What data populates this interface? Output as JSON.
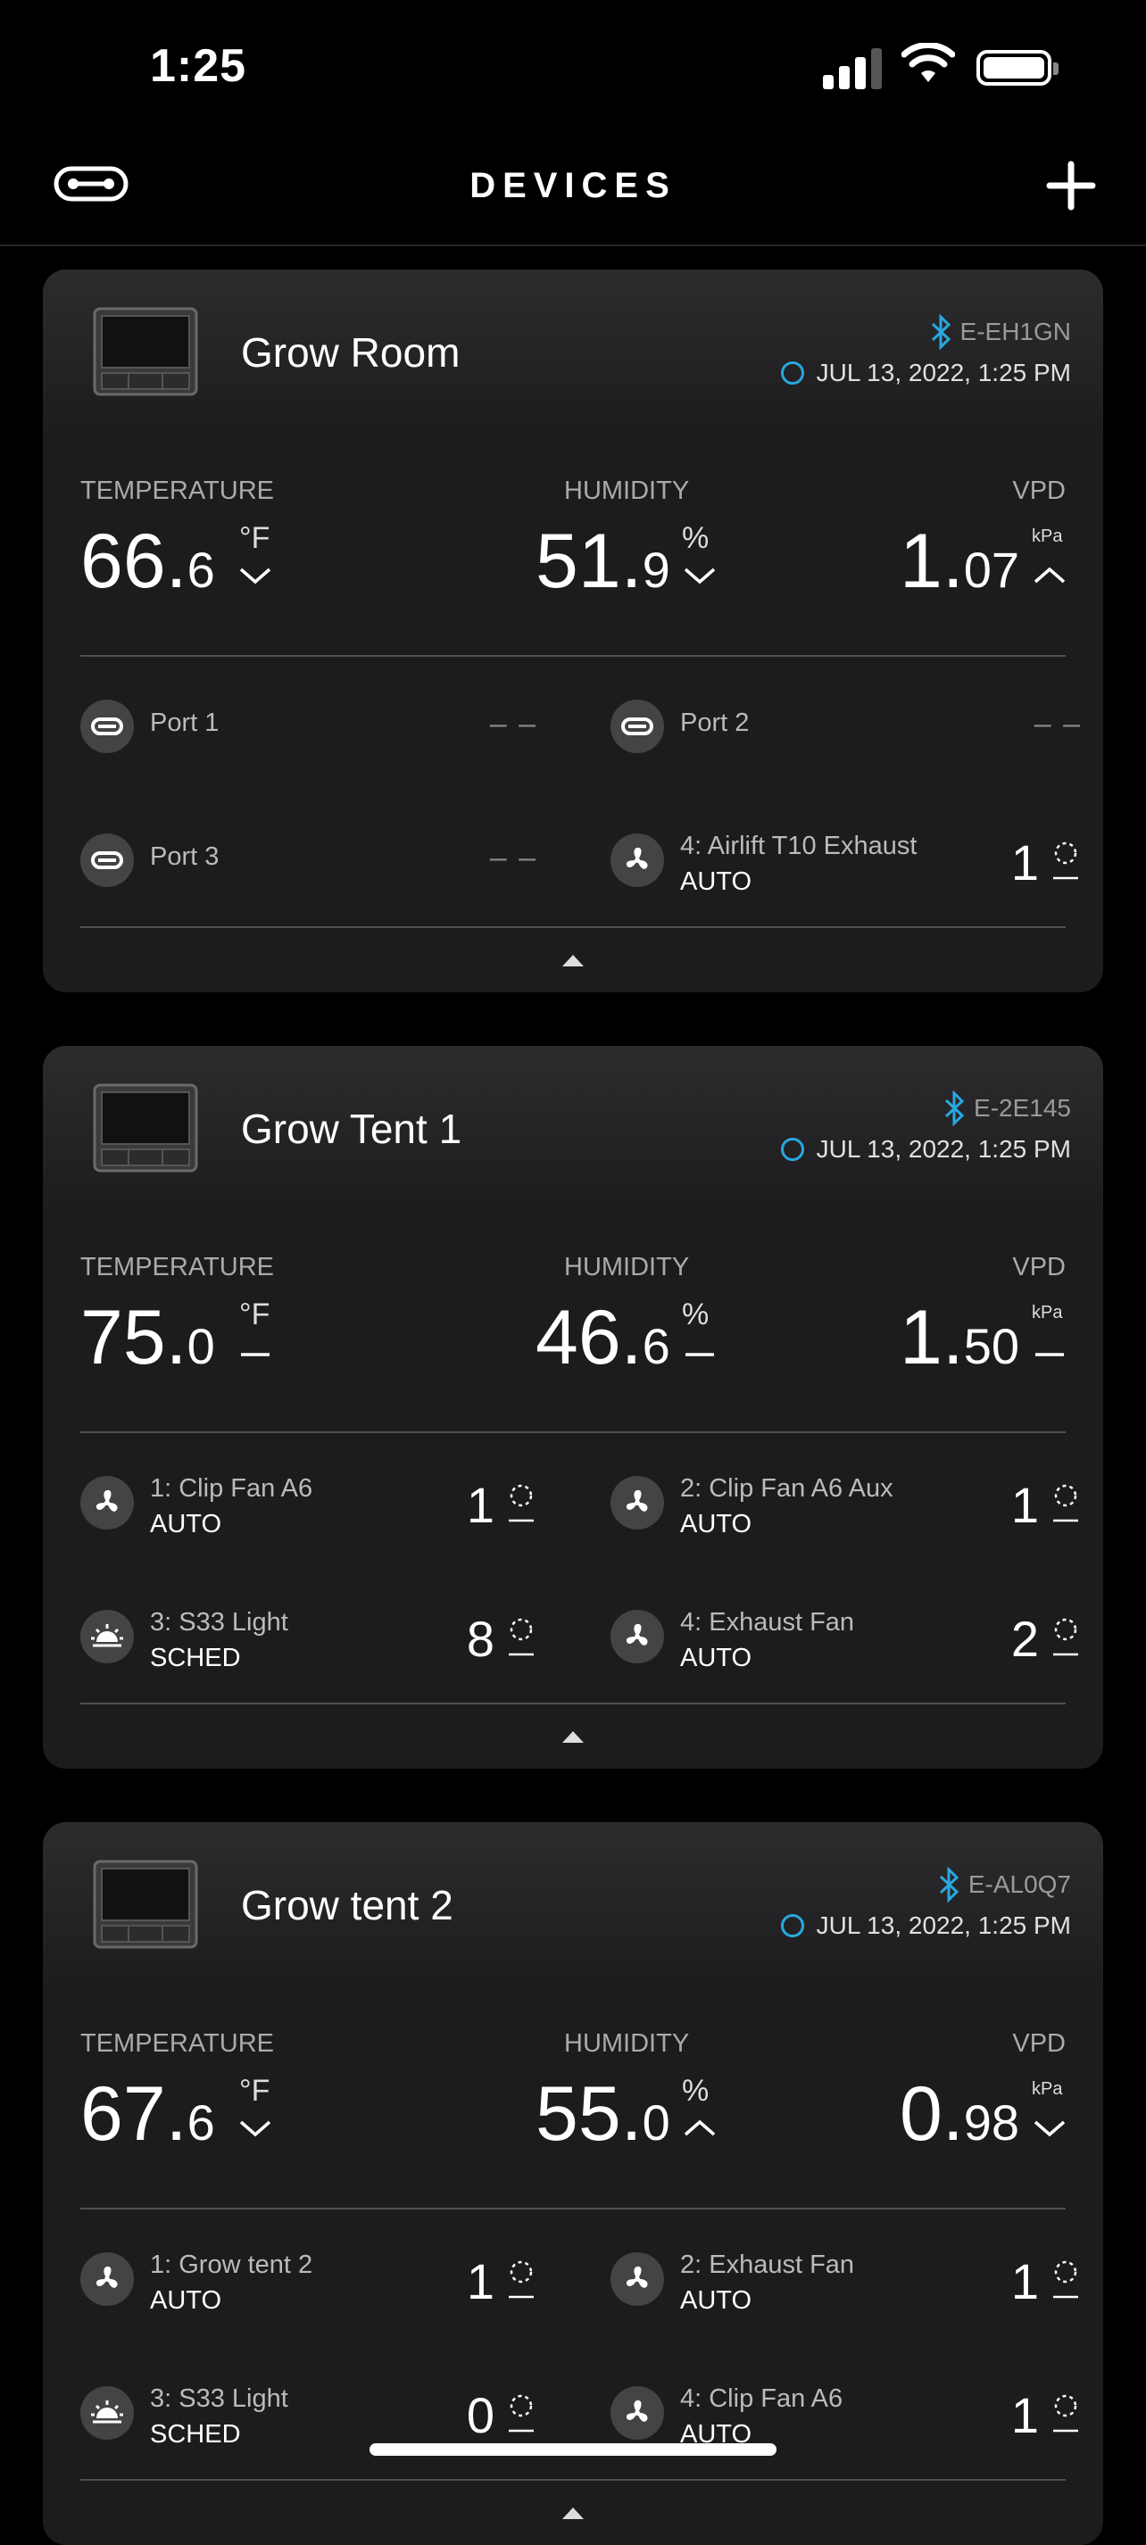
{
  "status_bar": {
    "time": "1:25"
  },
  "nav": {
    "title": "DEVICES"
  },
  "devices": [
    {
      "name": "Grow Room",
      "id": "E-EH1GN",
      "timestamp": "JUL 13, 2022, 1:25 PM",
      "temperature": {
        "label": "TEMPERATURE",
        "int": "66.",
        "dec": "6",
        "unit": "°F",
        "trend": "down"
      },
      "humidity": {
        "label": "HUMIDITY",
        "int": "51.",
        "dec": "9",
        "unit": "%",
        "trend": "down"
      },
      "vpd": {
        "label": "VPD",
        "int": "1.",
        "dec": "07",
        "unit": "kPa",
        "trend": "up"
      },
      "ports": [
        {
          "name": "Port 1",
          "value": "– –"
        },
        {
          "name": "Port 2",
          "value": "– –"
        },
        {
          "name": "Port 3",
          "value": "– –"
        },
        {
          "name": "4: Airlift T10 Exhaust",
          "mode": "AUTO",
          "level": "1"
        }
      ]
    },
    {
      "name": "Grow Tent 1",
      "id": "E-2E145",
      "timestamp": "JUL 13, 2022, 1:25 PM",
      "temperature": {
        "label": "TEMPERATURE",
        "int": "75.",
        "dec": "0",
        "unit": "°F",
        "trend": "flat"
      },
      "humidity": {
        "label": "HUMIDITY",
        "int": "46.",
        "dec": "6",
        "unit": "%",
        "trend": "flat"
      },
      "vpd": {
        "label": "VPD",
        "int": "1.",
        "dec": "50",
        "unit": "kPa",
        "trend": "flat"
      },
      "ports": [
        {
          "name": "1: Clip Fan A6",
          "mode": "AUTO",
          "level": "1"
        },
        {
          "name": "2: Clip Fan A6 Aux",
          "mode": "AUTO",
          "level": "1"
        },
        {
          "name": "3: S33 Light",
          "mode": "SCHED",
          "level": "8"
        },
        {
          "name": "4: Exhaust Fan",
          "mode": "AUTO",
          "level": "2"
        }
      ]
    },
    {
      "name": "Grow tent 2",
      "id": "E-AL0Q7",
      "timestamp": "JUL 13, 2022, 1:25 PM",
      "temperature": {
        "label": "TEMPERATURE",
        "int": "67.",
        "dec": "6",
        "unit": "°F",
        "trend": "down"
      },
      "humidity": {
        "label": "HUMIDITY",
        "int": "55.",
        "dec": "0",
        "unit": "%",
        "trend": "up"
      },
      "vpd": {
        "label": "VPD",
        "int": "0.",
        "dec": "98",
        "unit": "kPa",
        "trend": "down"
      },
      "ports": [
        {
          "name": "1: Grow tent 2",
          "mode": "AUTO",
          "level": "1"
        },
        {
          "name": "2: Exhaust Fan",
          "mode": "AUTO",
          "level": "1"
        },
        {
          "name": "3: S33 Light",
          "mode": "SCHED",
          "level": "0"
        },
        {
          "name": "4: Clip Fan A6",
          "mode": "AUTO",
          "level": "1"
        }
      ]
    }
  ],
  "colors": {
    "accent": "#29a8e0",
    "card_bg": "#1c1c1e",
    "icon_bg": "#444446"
  }
}
